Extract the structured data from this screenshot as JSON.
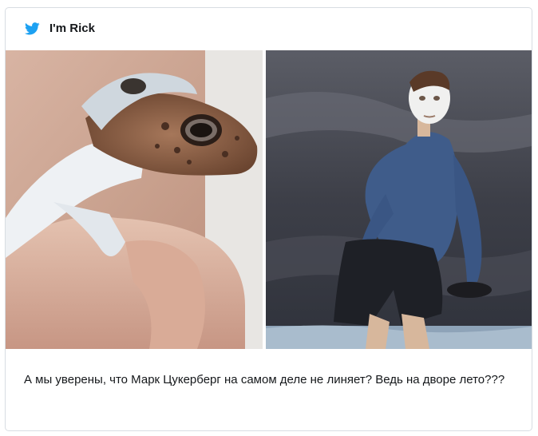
{
  "tweet": {
    "author": "I'm Rick",
    "text": "А мы уверены, что Марк Цукерберг на самом деле не линяет? Ведь на дворе лето???"
  },
  "icons": {
    "brand": "twitter-bird-icon",
    "brand_color": "#1da1f2"
  },
  "media": {
    "left": {
      "subject": "shedding gecko in a hand"
    },
    "right": {
      "subject": "man in blue shirt with white sunscreen on face by water"
    }
  }
}
